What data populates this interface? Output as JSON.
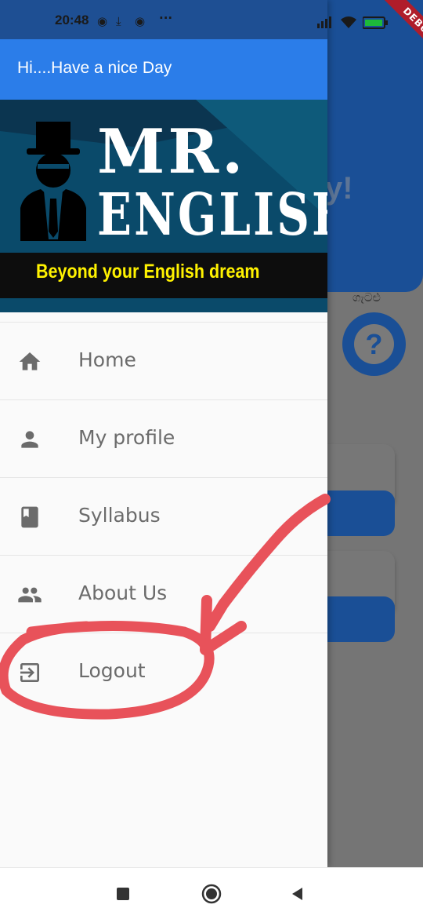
{
  "status_bar": {
    "time": "20:48"
  },
  "debug_banner": "DEBUG",
  "drawer": {
    "header_greeting": "Hi....Have a nice Day",
    "banner": {
      "title_line1": "MR.",
      "title_line2": "ENGLISH",
      "tagline": "Beyond your English dream"
    },
    "items": [
      {
        "label": "Home",
        "icon": "home-icon"
      },
      {
        "label": "My profile",
        "icon": "person-icon"
      },
      {
        "label": "Syllabus",
        "icon": "book-icon"
      },
      {
        "label": "About Us",
        "icon": "people-icon"
      },
      {
        "label": "Logout",
        "icon": "logout-icon"
      }
    ]
  },
  "background": {
    "greeting_fragment": "y!",
    "help_label": "ගැටළු",
    "help_symbol": "?"
  },
  "colors": {
    "drawer_header": "#2b7de9",
    "status_bar": "#1e4f93",
    "tagline": "#fff200",
    "annotation": "#e8525a"
  }
}
